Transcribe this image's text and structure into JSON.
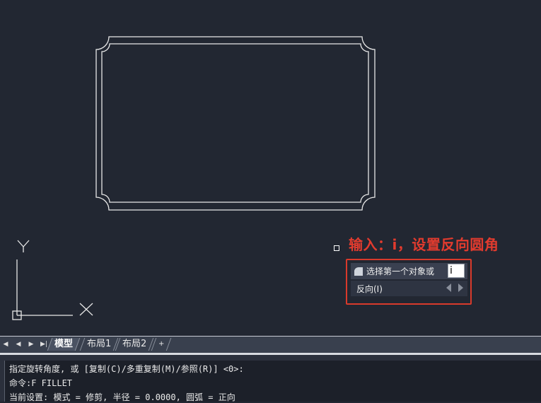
{
  "annotation": "输入：i，设置反向圆角",
  "tooltip": {
    "prompt": "选择第一个对象或",
    "input_value": "i",
    "option": "反向(I)"
  },
  "ucs": {
    "x_label": "X",
    "y_label": "Y"
  },
  "tabs": [
    {
      "label": "模型",
      "active": true
    },
    {
      "label": "布局1",
      "active": false
    },
    {
      "label": "布局2",
      "active": false
    },
    {
      "label": "+",
      "active": false
    }
  ],
  "nav_buttons": [
    "◀",
    "◀",
    "▶",
    "▶|"
  ],
  "command_lines": [
    "指定旋转角度, 或 [复制(C)/多重复制(M)/参照(R)] <0>:",
    "命令:F FILLET",
    "当前设置: 模式 = 修剪, 半径 = 0.0000, 圆弧 = 正向"
  ],
  "colors": {
    "canvas_bg": "#222732",
    "line": "#e8e8e8",
    "accent_red": "#e23b2e"
  }
}
